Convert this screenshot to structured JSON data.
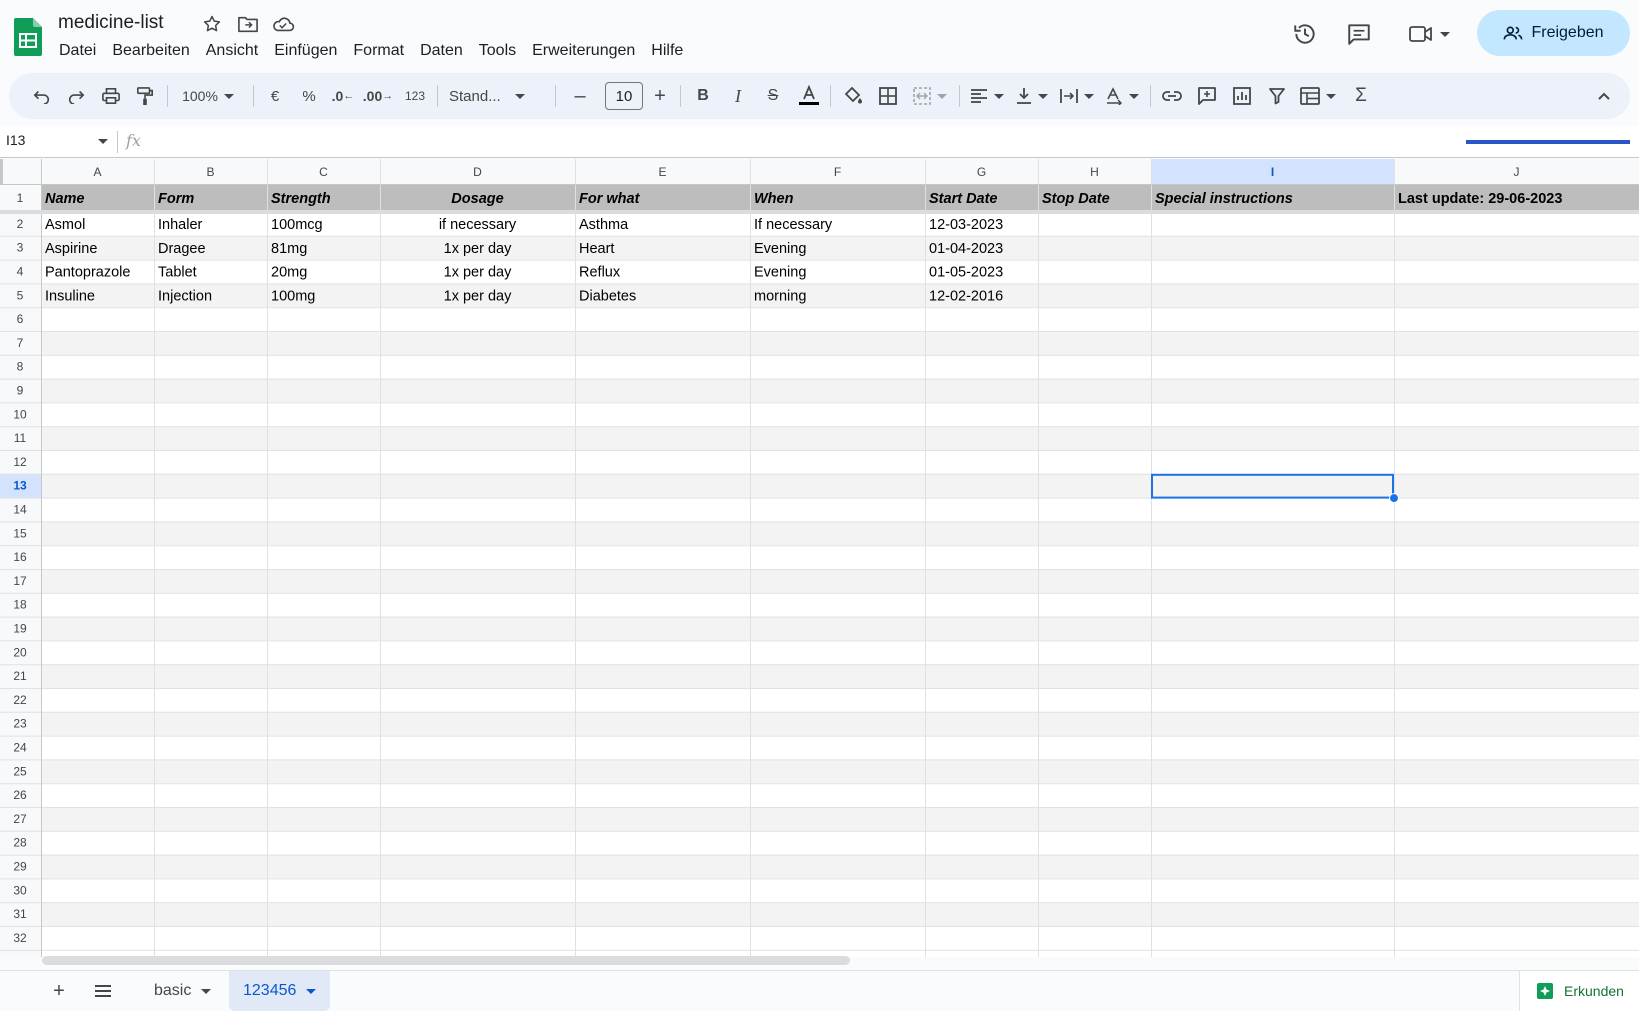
{
  "document": {
    "title": "medicine-list"
  },
  "menu": [
    "Datei",
    "Bearbeiten",
    "Ansicht",
    "Einfügen",
    "Format",
    "Daten",
    "Tools",
    "Erweiterungen",
    "Hilfe"
  ],
  "share_label": "Freigeben",
  "toolbar": {
    "zoom": "100%",
    "currency": "€",
    "percent": "%",
    "decrease_decimals": ".0",
    "increase_decimals": ".00",
    "number_format": "123",
    "font": "Stand...",
    "font_size": "10"
  },
  "formula_bar": {
    "name_box": "I13",
    "fx": "fx",
    "value": ""
  },
  "grid": {
    "columns": [
      "A",
      "B",
      "C",
      "D",
      "E",
      "F",
      "G",
      "H",
      "I",
      "J"
    ],
    "selected_column": "I",
    "selected_row": "13",
    "rows": [
      "1",
      "2",
      "3",
      "4",
      "5",
      "6",
      "7",
      "8",
      "9",
      "10",
      "11",
      "12",
      "13",
      "14",
      "15",
      "16",
      "17",
      "18",
      "19",
      "20",
      "21",
      "22",
      "23",
      "24",
      "25",
      "26",
      "27",
      "28",
      "29",
      "30",
      "31",
      "32"
    ],
    "header_row": [
      "Name",
      "Form",
      "Strength",
      "Dosage",
      "For what",
      "When",
      "Start Date",
      "Stop Date",
      "Special instructions",
      "Last update: 29-06-2023"
    ],
    "data_rows": [
      [
        "Asmol",
        "Inhaler",
        "100mcg",
        "if necessary",
        "Asthma",
        "If necessary",
        "12-03-2023",
        "",
        "",
        ""
      ],
      [
        "Aspirine",
        "Dragee",
        "81mg",
        "1x per day",
        "Heart",
        "Evening",
        "01-04-2023",
        "",
        "",
        ""
      ],
      [
        "Pantoprazole",
        "Tablet",
        "20mg",
        "1x per day",
        "Reflux",
        "Evening",
        "01-05-2023",
        "",
        "",
        ""
      ],
      [
        "Insuline",
        "Injection",
        "100mg",
        "1x per day",
        "Diabetes",
        "morning",
        "12-02-2016",
        "",
        "",
        ""
      ]
    ]
  },
  "sheets": {
    "tabs": [
      {
        "label": "basic",
        "active": false
      },
      {
        "label": "123456",
        "active": true
      }
    ],
    "explore_label": "Erkunden"
  },
  "colors": {
    "accent": "#0b57d0",
    "share_bg": "#c2e7ff",
    "header_row_bg": "#bdbdbd",
    "band_bg": "#f3f3f3",
    "selection": "#1a73e8",
    "selected_header_bg": "#d3e3fd"
  },
  "icons": [
    "sheets-logo-icon",
    "star-icon",
    "move-folder-icon",
    "cloud-saved-icon",
    "history-icon",
    "comment-icon",
    "meet-video-icon",
    "share-people-icon"
  ]
}
